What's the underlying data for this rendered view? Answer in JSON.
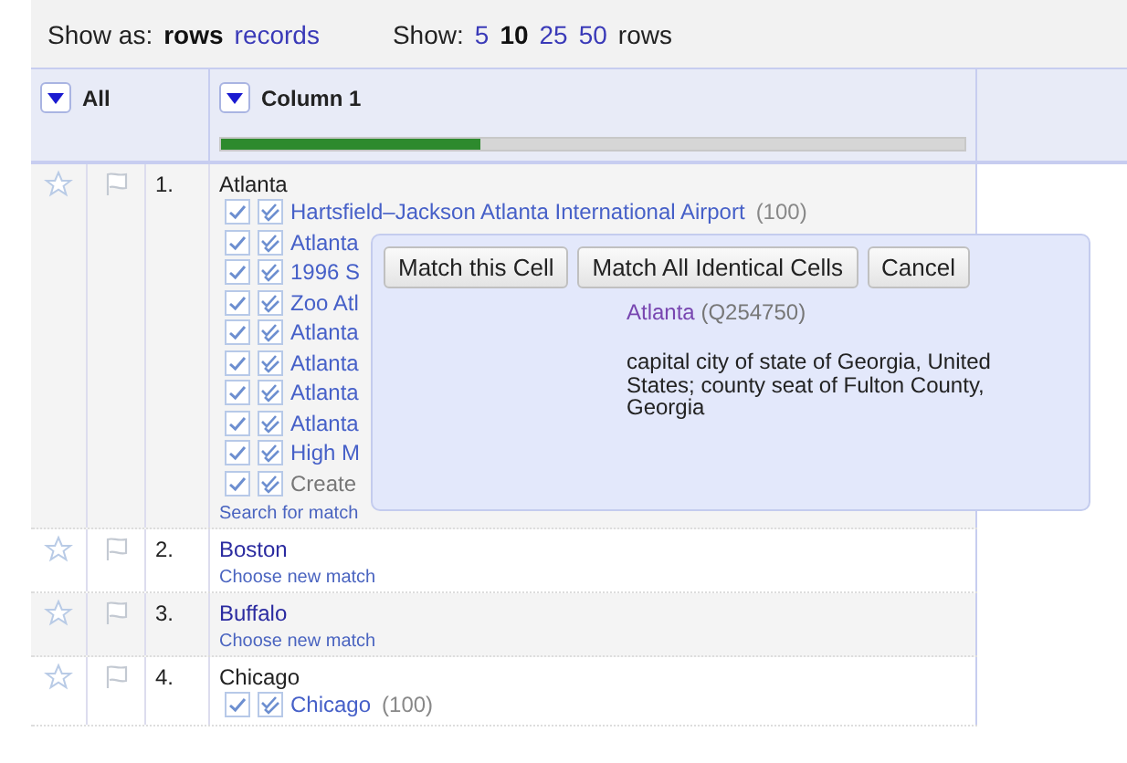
{
  "view_bar": {
    "show_as_label": "Show as:",
    "modes": [
      {
        "label": "rows",
        "selected": true
      },
      {
        "label": "records",
        "selected": false
      }
    ],
    "show_label": "Show:",
    "page_sizes": [
      {
        "label": "5",
        "selected": false
      },
      {
        "label": "10",
        "selected": true
      },
      {
        "label": "25",
        "selected": false
      },
      {
        "label": "50",
        "selected": false
      }
    ],
    "unit": "rows"
  },
  "columns": [
    {
      "label": "All"
    },
    {
      "label": "Column 1",
      "level": 0.35
    }
  ],
  "rows": [
    {
      "number": "1.",
      "value": "Atlanta",
      "kind": "candidates",
      "candidates": [
        {
          "name": "Hartsfield–Jackson Atlanta International Airport",
          "score": "(100)",
          "kind": "entity"
        },
        {
          "name": "Atlanta",
          "kind": "entity"
        },
        {
          "name": "1996 S",
          "kind": "entity"
        },
        {
          "name": "Zoo Atl",
          "kind": "entity"
        },
        {
          "name": "Atlanta",
          "kind": "entity"
        },
        {
          "name": "Atlanta",
          "kind": "entity"
        },
        {
          "name": "Atlanta",
          "kind": "entity"
        },
        {
          "name": "Atlanta",
          "kind": "entity"
        },
        {
          "name": "High M",
          "kind": "entity"
        },
        {
          "name": "Create",
          "kind": "new"
        }
      ],
      "action": "Search for match"
    },
    {
      "number": "2.",
      "value": "Boston",
      "kind": "matched",
      "action": "Choose new match"
    },
    {
      "number": "3.",
      "value": "Buffalo",
      "kind": "matched",
      "action": "Choose new match"
    },
    {
      "number": "4.",
      "value": "Chicago",
      "kind": "candidates",
      "candidates": [
        {
          "name": "Chicago",
          "score": "(100)",
          "kind": "entity"
        }
      ]
    }
  ],
  "popup": {
    "buttons": [
      "Match this Cell",
      "Match All Identical Cells",
      "Cancel"
    ],
    "entity": "Atlanta",
    "entity_id": "(Q254750)",
    "description": "capital city of state of Georgia, United States; county seat of Fulton County, Georgia"
  }
}
